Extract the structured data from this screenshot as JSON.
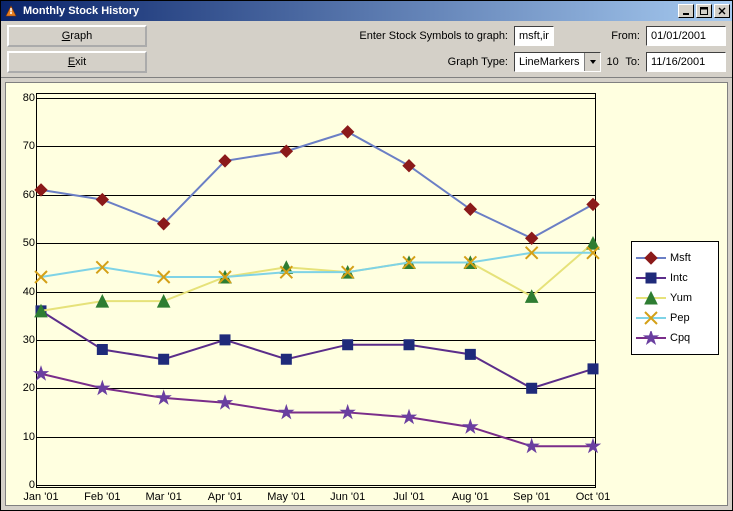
{
  "window": {
    "title": "Monthly Stock History"
  },
  "toolbar": {
    "symbols_label": "Enter Stock Symbols to graph:",
    "symbols_value": "msft,intc,yum,pep,cpq",
    "graph_type_label": "Graph Type:",
    "graph_type_value": "LineMarkers",
    "graph_type_count": "10",
    "from_label": "From:",
    "from_value": "01/01/2001",
    "to_label": "To:",
    "to_value": "11/16/2001",
    "graph_button": "Graph",
    "exit_button": "Exit"
  },
  "legend": {
    "items": [
      {
        "label": "Msft",
        "color": "#6b7fc5",
        "marker": "diamond",
        "markerColor": "#8b1a1a"
      },
      {
        "label": "Intc",
        "color": "#5b2d8a",
        "marker": "square",
        "markerColor": "#1f2a7a"
      },
      {
        "label": "Yum",
        "color": "#e6e27a",
        "marker": "triangle",
        "markerColor": "#2e7d32"
      },
      {
        "label": "Pep",
        "color": "#7fd3e6",
        "marker": "x",
        "markerColor": "#d4a017"
      },
      {
        "label": "Cpq",
        "color": "#7a2d8a",
        "marker": "star",
        "markerColor": "#6a3fa0"
      }
    ]
  },
  "chart_data": {
    "type": "line",
    "title": "",
    "xlabel": "",
    "ylabel": "",
    "ylim": [
      0,
      80
    ],
    "categories": [
      "Jan '01",
      "Feb '01",
      "Mar '01",
      "Apr '01",
      "May '01",
      "Jun '01",
      "Jul '01",
      "Aug '01",
      "Sep '01",
      "Oct '01"
    ],
    "yticks": [
      0,
      10,
      20,
      30,
      40,
      50,
      60,
      70,
      80
    ],
    "series": [
      {
        "name": "Msft",
        "marker": "diamond",
        "color": "#6b7fc5",
        "markerColor": "#8b1a1a",
        "values": [
          61,
          59,
          54,
          67,
          69,
          73,
          66,
          57,
          51,
          58
        ]
      },
      {
        "name": "Intc",
        "marker": "square",
        "color": "#5b2d8a",
        "markerColor": "#1f2a7a",
        "values": [
          36,
          28,
          26,
          30,
          26,
          29,
          29,
          27,
          20,
          24
        ]
      },
      {
        "name": "Yum",
        "marker": "triangle",
        "color": "#e6e27a",
        "markerColor": "#2e7d32",
        "values": [
          36,
          38,
          38,
          43,
          45,
          44,
          46,
          46,
          39,
          50
        ]
      },
      {
        "name": "Pep",
        "marker": "x",
        "color": "#7fd3e6",
        "markerColor": "#d4a017",
        "values": [
          43,
          45,
          43,
          43,
          44,
          44,
          46,
          46,
          48,
          48
        ]
      },
      {
        "name": "Cpq",
        "marker": "star",
        "color": "#7a2d8a",
        "markerColor": "#6a3fa0",
        "values": [
          23,
          20,
          18,
          17,
          15,
          15,
          14,
          12,
          8,
          8
        ]
      }
    ]
  }
}
